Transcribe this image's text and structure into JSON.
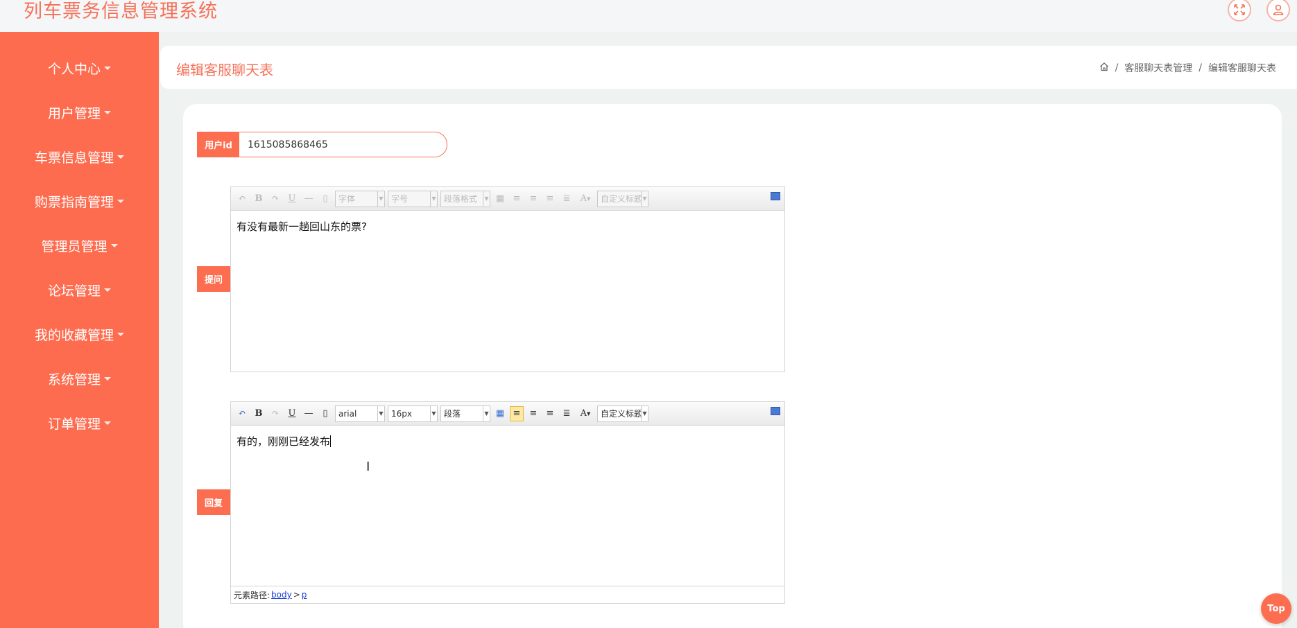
{
  "app": {
    "title": "列车票务信息管理系统"
  },
  "sidebar": {
    "items": [
      {
        "label": "个人中心"
      },
      {
        "label": "用户管理"
      },
      {
        "label": "车票信息管理"
      },
      {
        "label": "购票指南管理"
      },
      {
        "label": "管理员管理"
      },
      {
        "label": "论坛管理"
      },
      {
        "label": "我的收藏管理"
      },
      {
        "label": "系统管理"
      },
      {
        "label": "订单管理"
      }
    ]
  },
  "header": {
    "page_title": "编辑客服聊天表",
    "breadcrumb": [
      "客服聊天表管理",
      "编辑客服聊天表"
    ],
    "separator": "/"
  },
  "form": {
    "user_id_label": "用户id",
    "user_id_value": "1615085868465",
    "question_label": "提问",
    "question_text": "有没有最新一趟回山东的票?",
    "reply_label": "回复",
    "reply_text": "有的，刚刚已经发布"
  },
  "editor_toolbar": {
    "font_family_placeholder": "字体",
    "font_size_placeholder": "字号",
    "paragraph_placeholder": "段落格式",
    "custom_title": "自定义标题",
    "font_family_value": "arial",
    "font_size_value": "16px",
    "paragraph_value": "段落",
    "font_color_glyph": "A"
  },
  "statusbar": {
    "prefix": "元素路径:",
    "path": [
      "body",
      "p"
    ],
    "sep": ">"
  },
  "top_button": {
    "label": "Top"
  },
  "colors": {
    "accent": "#fd6d50",
    "title": "#f4735a"
  }
}
